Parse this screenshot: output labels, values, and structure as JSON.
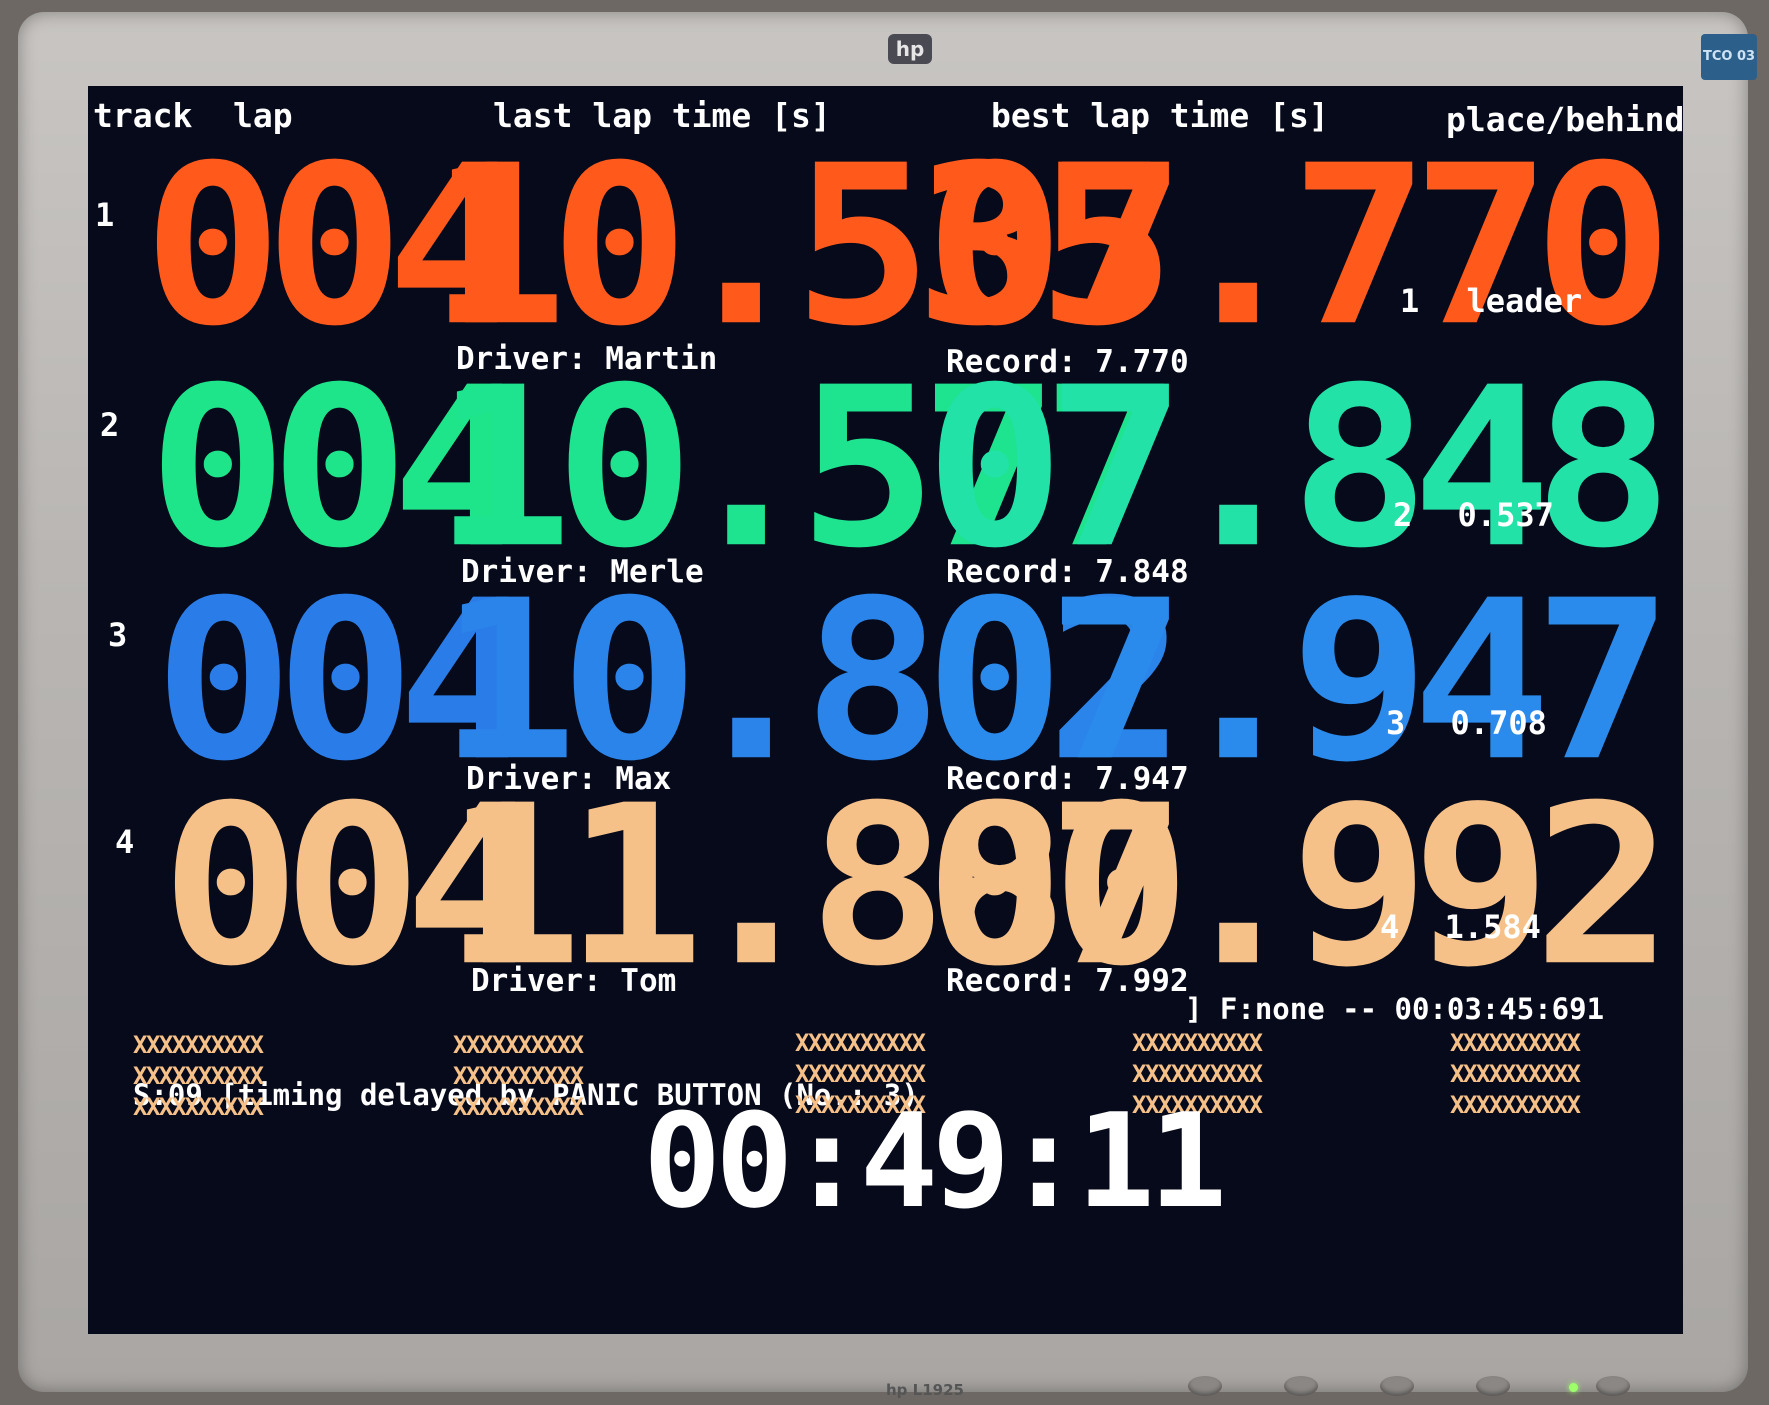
{
  "brand": {
    "logo": "hp",
    "model": "hp L1925",
    "sticker": "TCO 03"
  },
  "header": {
    "track": "track",
    "lap": "lap",
    "last_lap": "last lap time [s]",
    "best_lap": "best lap time [s]",
    "place": "place/behind"
  },
  "colors": {
    "track1": "#ff5a1c",
    "track2": "#1fe58a",
    "track3": "#2a7de8",
    "track4": "#f6c189",
    "screen_bg": "#070a1a"
  },
  "tracks": [
    {
      "track": "1",
      "lap": "004",
      "last": "10.535",
      "best": "07.770",
      "driver_label": "Driver: Martin",
      "record_label": "Record: 7.770",
      "place": "1",
      "behind": "leader"
    },
    {
      "track": "2",
      "lap": "004",
      "last": "10.577",
      "best": "07.848",
      "driver_label": "Driver: Merle",
      "record_label": "Record: 7.848",
      "place": "2",
      "behind": "0.537"
    },
    {
      "track": "3",
      "lap": "004",
      "last": "10.802",
      "best": "07.947",
      "driver_label": "Driver: Max",
      "record_label": "Record: 7.947",
      "place": "3",
      "behind": "0.708"
    },
    {
      "track": "4",
      "lap": "004",
      "last": "11.880",
      "best": "07.992",
      "driver_label": "Driver: Tom",
      "record_label": "Record: 7.992",
      "place": "4",
      "behind": "1.584"
    }
  ],
  "status": {
    "left": "S:09 [timing delayed by PANIC BUTTON (No.: 3)",
    "right": "] F:none -- 00:03:45:691"
  },
  "x_pattern": "XXXXXXXXXX",
  "clock": "00:49:11"
}
